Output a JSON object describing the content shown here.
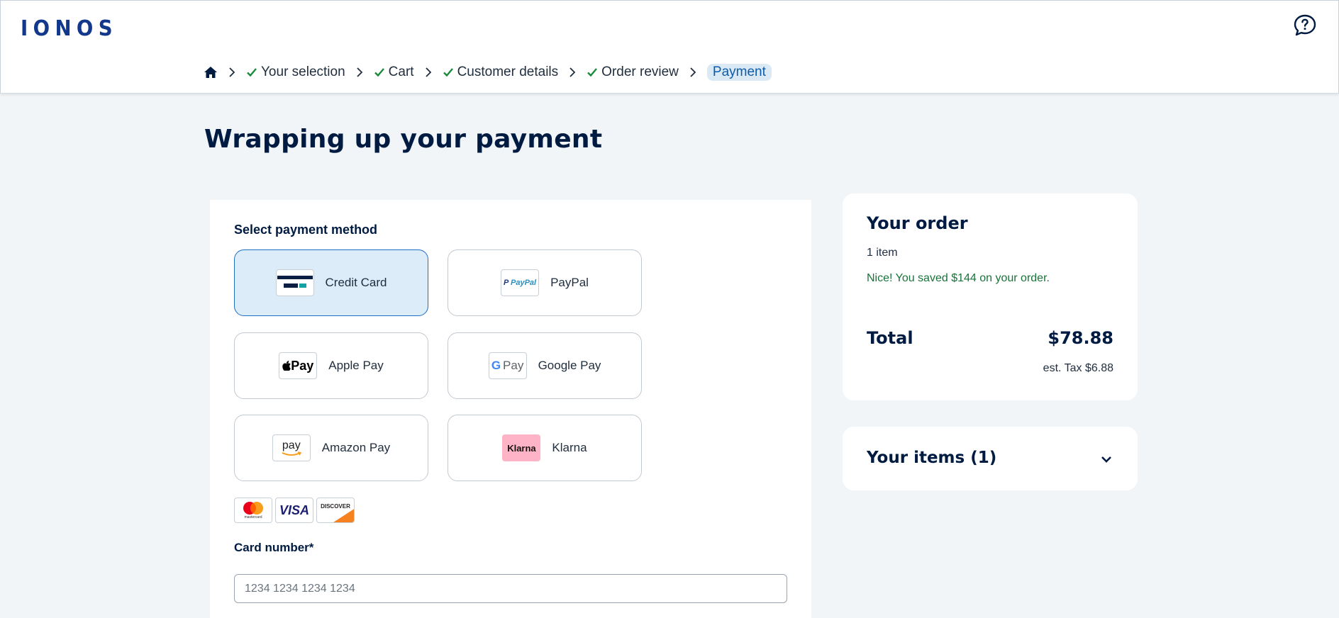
{
  "header": {
    "logo": "IONOS",
    "help_icon": "chat-help-icon"
  },
  "breadcrumb": {
    "home_icon": "home-icon",
    "steps": [
      "Your selection",
      "Cart",
      "Customer details",
      "Order review"
    ],
    "current": "Payment"
  },
  "page": {
    "title": "Wrapping up your payment"
  },
  "payment": {
    "section_label": "Select payment method",
    "methods": [
      {
        "label": "Credit Card",
        "logo": "credit-card-icon",
        "selected": true
      },
      {
        "label": "PayPal",
        "logo_text": "PayPal"
      },
      {
        "label": "Apple Pay",
        "logo_text": "Pay"
      },
      {
        "label": "Google Pay",
        "logo_text": "Pay"
      },
      {
        "label": "Amazon Pay",
        "logo_text": "pay"
      },
      {
        "label": "Klarna",
        "logo_text": "Klarna"
      }
    ],
    "card_brands": [
      "mastercard",
      "VISA",
      "DISCOVER"
    ],
    "card_number_label": "Card number*",
    "card_number_placeholder": "1234 1234 1234 1234"
  },
  "order": {
    "title": "Your order",
    "item_count": "1 item",
    "savings": "Nice! You saved $144 on your order.",
    "total_label": "Total",
    "total_value": "$78.88",
    "tax": "est. Tax $6.88"
  },
  "items": {
    "title": "Your items (1)"
  },
  "colors": {
    "brand": "#11388a",
    "text": "#001b41",
    "selected_bg": "#dcecf8",
    "selected_border": "#1c6fc1",
    "success": "#19733a",
    "check": "#1a8a3c",
    "background": "#f2f5f8"
  }
}
